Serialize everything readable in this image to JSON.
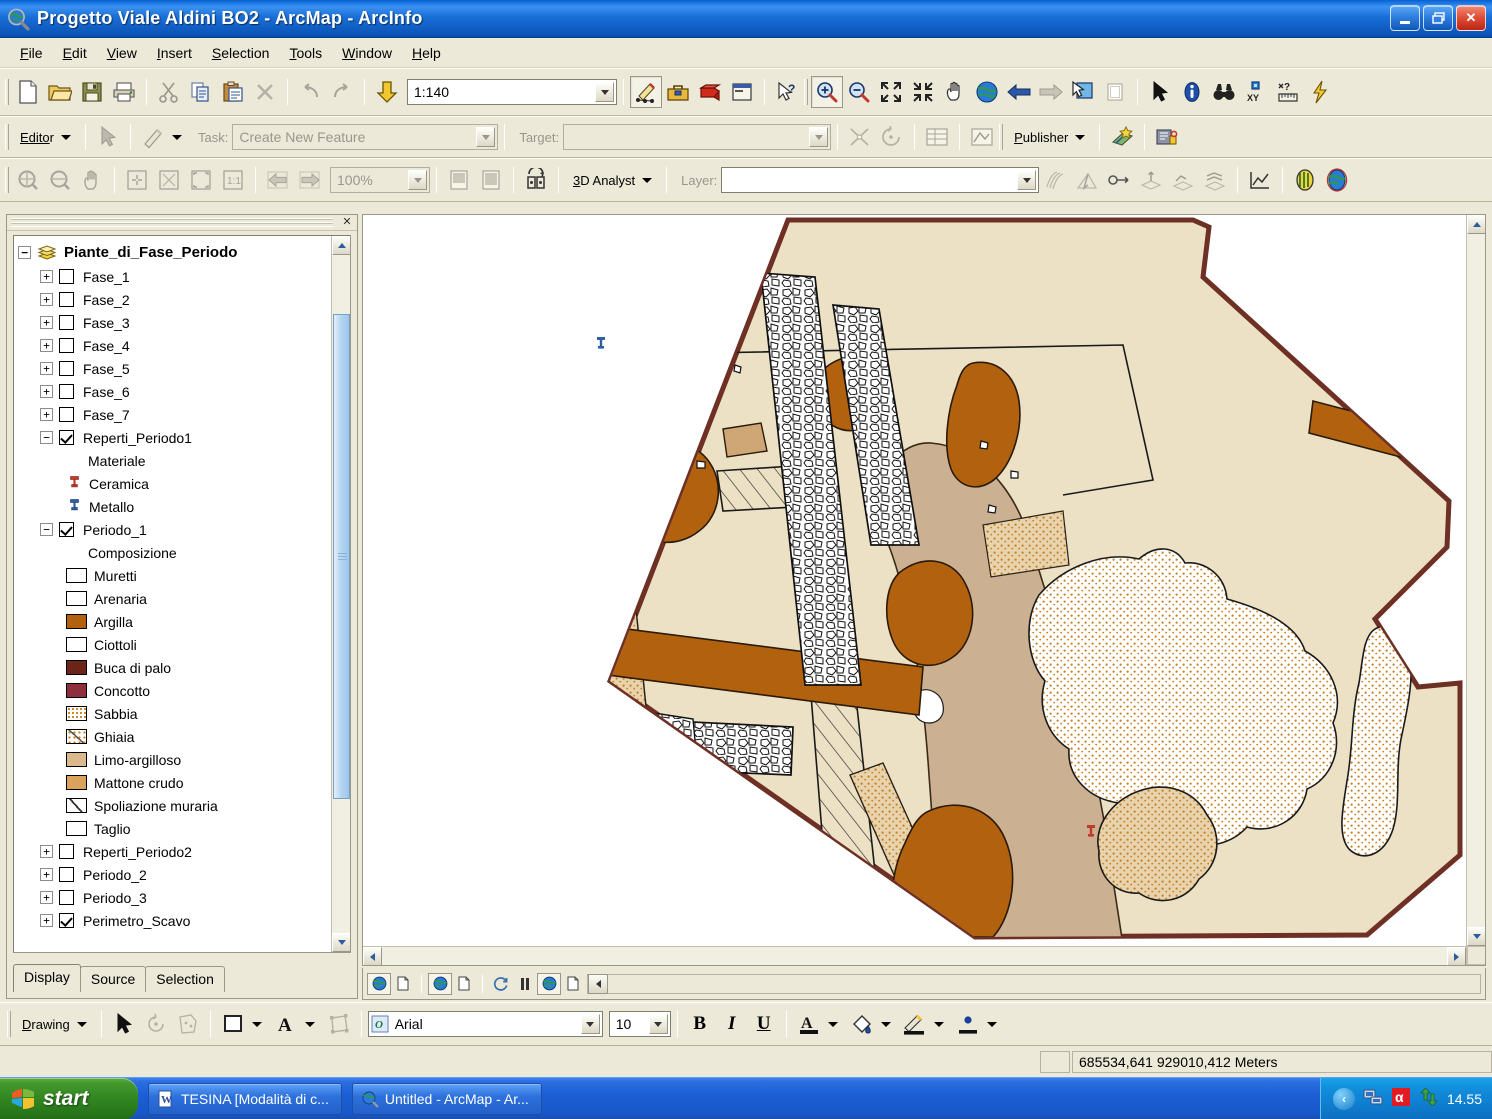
{
  "window": {
    "title": "Progetto Viale Aldini BO2 - ArcMap - ArcInfo",
    "app_icon": "globe-magnifier-icon",
    "minimize_label": "_",
    "maximize_label": "❐",
    "close_label": "✕"
  },
  "menubar": {
    "items": [
      {
        "label": "File",
        "mnemonic": "F"
      },
      {
        "label": "Edit",
        "mnemonic": "E"
      },
      {
        "label": "View",
        "mnemonic": "V"
      },
      {
        "label": "Insert",
        "mnemonic": "I"
      },
      {
        "label": "Selection",
        "mnemonic": "S"
      },
      {
        "label": "Tools",
        "mnemonic": "T"
      },
      {
        "label": "Window",
        "mnemonic": "W"
      },
      {
        "label": "Help",
        "mnemonic": "H"
      }
    ]
  },
  "standard_toolbar": {
    "scale_value": "1:140",
    "buttons": [
      "new-document-icon",
      "open-folder-icon",
      "save-icon",
      "print-icon",
      "cut-scissors-icon",
      "copy-icon",
      "paste-icon",
      "delete-x-icon",
      "undo-arrow-icon",
      "redo-arrow-icon",
      "add-data-icon"
    ],
    "after_scale_buttons": [
      "editor-toolbar-icon",
      "toolbox-icon",
      "arctoolbox-red-icon",
      "command-line-icon",
      "help-pointer-icon"
    ],
    "tools": [
      "zoom-in-icon",
      "zoom-out-icon",
      "fixed-zoom-in-icon",
      "fixed-zoom-out-icon",
      "pan-hand-icon",
      "full-extent-globe-icon",
      "back-extent-arrow-icon",
      "forward-extent-arrow-icon",
      "select-features-icon",
      "clear-selection-icon",
      "select-elements-arrow-icon",
      "identify-info-icon",
      "find-binoculars-icon",
      "go-to-xy-icon",
      "measure-icon",
      "hyperlink-lightning-icon"
    ]
  },
  "editor_toolbar": {
    "editor_label": "Editor",
    "task_label": "Task:",
    "task_value": "Create New Feature",
    "target_label": "Target:",
    "target_value": "",
    "publisher_label": "Publisher",
    "buttons": [
      "edit-arrow-icon",
      "sketch-pencil-icon",
      "split-icon",
      "rotate-icon",
      "attributes-table-icon",
      "sketch-properties-icon",
      "publisher-star-icon",
      "publisher-protect-icon"
    ]
  },
  "analyst_toolbar": {
    "analyst_label": "3D Analyst",
    "layer_label": "Layer:",
    "layer_value": "",
    "zoom_value": "100%",
    "buttons": [
      "zoom-in-page-icon",
      "zoom-out-page-icon",
      "pan-page-icon",
      "fit-page-icon",
      "zoom-whole-page-icon",
      "zoom-page-width-icon",
      "zoom-1-1-icon",
      "go-back-page-icon",
      "go-forward-page-icon",
      "toggle-draft-icon",
      "data-view-icon",
      "layout-view-icon",
      "interpolate-line-icon",
      "steepest-path-icon",
      "line-of-sight-icon",
      "create-contour-icon",
      "profile-graph-icon",
      "create-tin-icon",
      "scene-globe-icon",
      "arcglobe-icon"
    ]
  },
  "toc": {
    "close_label": "✕",
    "root": {
      "label": "Piante_di_Fase_Periodo",
      "icon": "layer-stack-icon",
      "expander": "−",
      "expanded": true
    },
    "items": [
      {
        "label": "Fase_1",
        "expander": "+",
        "checked": false,
        "type": "layer"
      },
      {
        "label": "Fase_2",
        "expander": "+",
        "checked": false,
        "type": "layer"
      },
      {
        "label": "Fase_3",
        "expander": "+",
        "checked": false,
        "type": "layer"
      },
      {
        "label": "Fase_4",
        "expander": "+",
        "checked": false,
        "type": "layer"
      },
      {
        "label": "Fase_5",
        "expander": "+",
        "checked": false,
        "type": "layer"
      },
      {
        "label": "Fase_6",
        "expander": "+",
        "checked": false,
        "type": "layer"
      },
      {
        "label": "Fase_7",
        "expander": "+",
        "checked": false,
        "type": "layer"
      },
      {
        "label": "Reperti_Periodo1",
        "expander": "−",
        "checked": true,
        "type": "layer"
      },
      {
        "label": "Materiale",
        "type": "field-heading"
      },
      {
        "label": "Ceramica",
        "type": "point-symbol",
        "icon": "pushpin-icon",
        "color": "#c0392b"
      },
      {
        "label": "Metallo",
        "type": "point-symbol",
        "icon": "pushpin-icon",
        "color": "#2e5fa3"
      },
      {
        "label": "Periodo_1",
        "expander": "−",
        "checked": true,
        "type": "layer"
      },
      {
        "label": "Composizione",
        "type": "field-heading"
      },
      {
        "label": "Muretti",
        "type": "poly-symbol",
        "fill": "#ffffff",
        "pattern": "solid"
      },
      {
        "label": "Arenaria",
        "type": "poly-symbol",
        "fill": "#ffffff",
        "pattern": "solid"
      },
      {
        "label": "Argilla",
        "type": "poly-symbol",
        "fill": "#b2620f",
        "pattern": "solid"
      },
      {
        "label": "Ciottoli",
        "type": "poly-symbol",
        "fill": "#ffffff",
        "pattern": "solid"
      },
      {
        "label": "Buca di palo",
        "type": "poly-symbol",
        "fill": "#6b2418",
        "pattern": "solid"
      },
      {
        "label": "Concotto",
        "type": "poly-symbol",
        "fill": "#8e2f3e",
        "pattern": "solid"
      },
      {
        "label": "Sabbia",
        "type": "poly-symbol",
        "fill": "#ffffff",
        "pattern": "dots"
      },
      {
        "label": "Ghiaia",
        "type": "poly-symbol",
        "fill": "#ffffff",
        "pattern": "gravel"
      },
      {
        "label": "Limo-argilloso",
        "type": "poly-symbol",
        "fill": "#dcb98a",
        "pattern": "solid"
      },
      {
        "label": "Mattone crudo",
        "type": "poly-symbol",
        "fill": "#d9a35e",
        "pattern": "solid"
      },
      {
        "label": "Spoliazione muraria",
        "type": "poly-symbol",
        "fill": "#ffffff",
        "pattern": "hatch"
      },
      {
        "label": "Taglio",
        "type": "poly-symbol",
        "fill": "#ffffff",
        "pattern": "solid"
      },
      {
        "label": "Reperti_Periodo2",
        "expander": "+",
        "checked": false,
        "type": "layer"
      },
      {
        "label": "Periodo_2",
        "expander": "+",
        "checked": false,
        "type": "layer"
      },
      {
        "label": "Periodo_3",
        "expander": "+",
        "checked": false,
        "type": "layer"
      },
      {
        "label": "Perimetro_Scavo",
        "expander": "+",
        "checked": true,
        "type": "layer"
      }
    ],
    "tabs": [
      {
        "label": "Display",
        "active": true
      },
      {
        "label": "Source",
        "active": false
      },
      {
        "label": "Selection",
        "active": false
      }
    ]
  },
  "map_statusstrip": {
    "buttons": [
      "draw-globe-icon",
      "draw-page-icon",
      "refresh-globe-icon",
      "refresh-page-icon",
      "continuous-refresh-icon",
      "pause-icon",
      "globe-toggle-icon",
      "page-toggle-icon"
    ]
  },
  "drawing_toolbar": {
    "drawing_label": "Drawing",
    "font_name": "Arial",
    "font_size": "10",
    "bold_label": "B",
    "italic_label": "I",
    "underline_label": "U",
    "buttons": [
      "select-elements-arrow-icon",
      "rotate-element-icon",
      "new-graphic-icon",
      "fill-color-icon",
      "font-color-A-icon",
      "drawing-sketch-icon",
      "text-color-icon",
      "fill-bucket-icon",
      "line-color-icon",
      "marker-color-icon"
    ]
  },
  "statusbar": {
    "coordinates": "685534,641  929010,412 Meters"
  },
  "taskbar": {
    "start_label": "start",
    "tasks": [
      {
        "label": "TESINA [Modalità di c...",
        "icon": "word-document-icon"
      },
      {
        "label": "Untitled - ArcMap - Ar...",
        "icon": "arcmap-globe-icon"
      }
    ],
    "tray": {
      "chevron": "‹",
      "icons": [
        "network-icon",
        "antivirus-icon",
        "updates-icon"
      ],
      "clock": "14.55"
    }
  },
  "map_colors": {
    "background_fill": "#ece1c4",
    "perimeter_line": "#6e3024",
    "argilla": "#b2620f",
    "limo_argilloso": "#cbb191",
    "mattone_crudo": "#d9a35e",
    "sabbia_dots": "#c97f20",
    "buca_di_palo": "#6b2418",
    "ceramica_point": "#c0392b",
    "metallo_point": "#2e5fa3"
  }
}
